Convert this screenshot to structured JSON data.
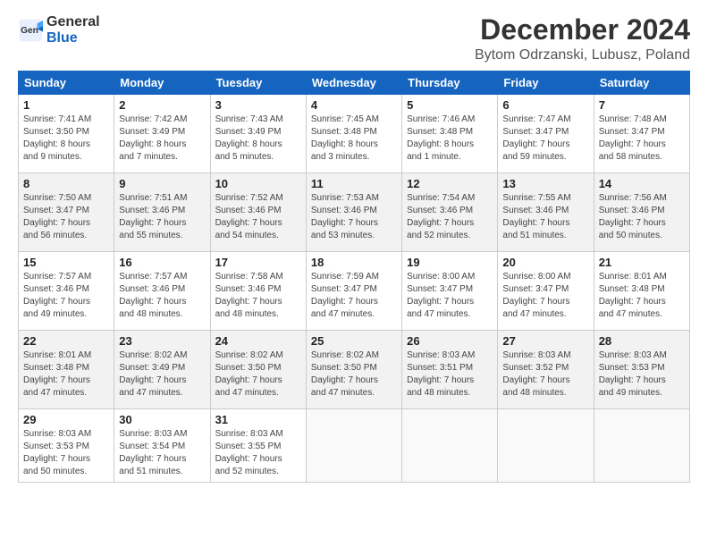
{
  "header": {
    "logo_general": "General",
    "logo_blue": "Blue",
    "month_title": "December 2024",
    "location": "Bytom Odrzanski, Lubusz, Poland"
  },
  "weekdays": [
    "Sunday",
    "Monday",
    "Tuesday",
    "Wednesday",
    "Thursday",
    "Friday",
    "Saturday"
  ],
  "weeks": [
    [
      {
        "day": "1",
        "detail": "Sunrise: 7:41 AM\nSunset: 3:50 PM\nDaylight: 8 hours\nand 9 minutes."
      },
      {
        "day": "2",
        "detail": "Sunrise: 7:42 AM\nSunset: 3:49 PM\nDaylight: 8 hours\nand 7 minutes."
      },
      {
        "day": "3",
        "detail": "Sunrise: 7:43 AM\nSunset: 3:49 PM\nDaylight: 8 hours\nand 5 minutes."
      },
      {
        "day": "4",
        "detail": "Sunrise: 7:45 AM\nSunset: 3:48 PM\nDaylight: 8 hours\nand 3 minutes."
      },
      {
        "day": "5",
        "detail": "Sunrise: 7:46 AM\nSunset: 3:48 PM\nDaylight: 8 hours\nand 1 minute."
      },
      {
        "day": "6",
        "detail": "Sunrise: 7:47 AM\nSunset: 3:47 PM\nDaylight: 7 hours\nand 59 minutes."
      },
      {
        "day": "7",
        "detail": "Sunrise: 7:48 AM\nSunset: 3:47 PM\nDaylight: 7 hours\nand 58 minutes."
      }
    ],
    [
      {
        "day": "8",
        "detail": "Sunrise: 7:50 AM\nSunset: 3:47 PM\nDaylight: 7 hours\nand 56 minutes."
      },
      {
        "day": "9",
        "detail": "Sunrise: 7:51 AM\nSunset: 3:46 PM\nDaylight: 7 hours\nand 55 minutes."
      },
      {
        "day": "10",
        "detail": "Sunrise: 7:52 AM\nSunset: 3:46 PM\nDaylight: 7 hours\nand 54 minutes."
      },
      {
        "day": "11",
        "detail": "Sunrise: 7:53 AM\nSunset: 3:46 PM\nDaylight: 7 hours\nand 53 minutes."
      },
      {
        "day": "12",
        "detail": "Sunrise: 7:54 AM\nSunset: 3:46 PM\nDaylight: 7 hours\nand 52 minutes."
      },
      {
        "day": "13",
        "detail": "Sunrise: 7:55 AM\nSunset: 3:46 PM\nDaylight: 7 hours\nand 51 minutes."
      },
      {
        "day": "14",
        "detail": "Sunrise: 7:56 AM\nSunset: 3:46 PM\nDaylight: 7 hours\nand 50 minutes."
      }
    ],
    [
      {
        "day": "15",
        "detail": "Sunrise: 7:57 AM\nSunset: 3:46 PM\nDaylight: 7 hours\nand 49 minutes."
      },
      {
        "day": "16",
        "detail": "Sunrise: 7:57 AM\nSunset: 3:46 PM\nDaylight: 7 hours\nand 48 minutes."
      },
      {
        "day": "17",
        "detail": "Sunrise: 7:58 AM\nSunset: 3:46 PM\nDaylight: 7 hours\nand 48 minutes."
      },
      {
        "day": "18",
        "detail": "Sunrise: 7:59 AM\nSunset: 3:47 PM\nDaylight: 7 hours\nand 47 minutes."
      },
      {
        "day": "19",
        "detail": "Sunrise: 8:00 AM\nSunset: 3:47 PM\nDaylight: 7 hours\nand 47 minutes."
      },
      {
        "day": "20",
        "detail": "Sunrise: 8:00 AM\nSunset: 3:47 PM\nDaylight: 7 hours\nand 47 minutes."
      },
      {
        "day": "21",
        "detail": "Sunrise: 8:01 AM\nSunset: 3:48 PM\nDaylight: 7 hours\nand 47 minutes."
      }
    ],
    [
      {
        "day": "22",
        "detail": "Sunrise: 8:01 AM\nSunset: 3:48 PM\nDaylight: 7 hours\nand 47 minutes."
      },
      {
        "day": "23",
        "detail": "Sunrise: 8:02 AM\nSunset: 3:49 PM\nDaylight: 7 hours\nand 47 minutes."
      },
      {
        "day": "24",
        "detail": "Sunrise: 8:02 AM\nSunset: 3:50 PM\nDaylight: 7 hours\nand 47 minutes."
      },
      {
        "day": "25",
        "detail": "Sunrise: 8:02 AM\nSunset: 3:50 PM\nDaylight: 7 hours\nand 47 minutes."
      },
      {
        "day": "26",
        "detail": "Sunrise: 8:03 AM\nSunset: 3:51 PM\nDaylight: 7 hours\nand 48 minutes."
      },
      {
        "day": "27",
        "detail": "Sunrise: 8:03 AM\nSunset: 3:52 PM\nDaylight: 7 hours\nand 48 minutes."
      },
      {
        "day": "28",
        "detail": "Sunrise: 8:03 AM\nSunset: 3:53 PM\nDaylight: 7 hours\nand 49 minutes."
      }
    ],
    [
      {
        "day": "29",
        "detail": "Sunrise: 8:03 AM\nSunset: 3:53 PM\nDaylight: 7 hours\nand 50 minutes."
      },
      {
        "day": "30",
        "detail": "Sunrise: 8:03 AM\nSunset: 3:54 PM\nDaylight: 7 hours\nand 51 minutes."
      },
      {
        "day": "31",
        "detail": "Sunrise: 8:03 AM\nSunset: 3:55 PM\nDaylight: 7 hours\nand 52 minutes."
      },
      {
        "day": "",
        "detail": ""
      },
      {
        "day": "",
        "detail": ""
      },
      {
        "day": "",
        "detail": ""
      },
      {
        "day": "",
        "detail": ""
      }
    ]
  ]
}
